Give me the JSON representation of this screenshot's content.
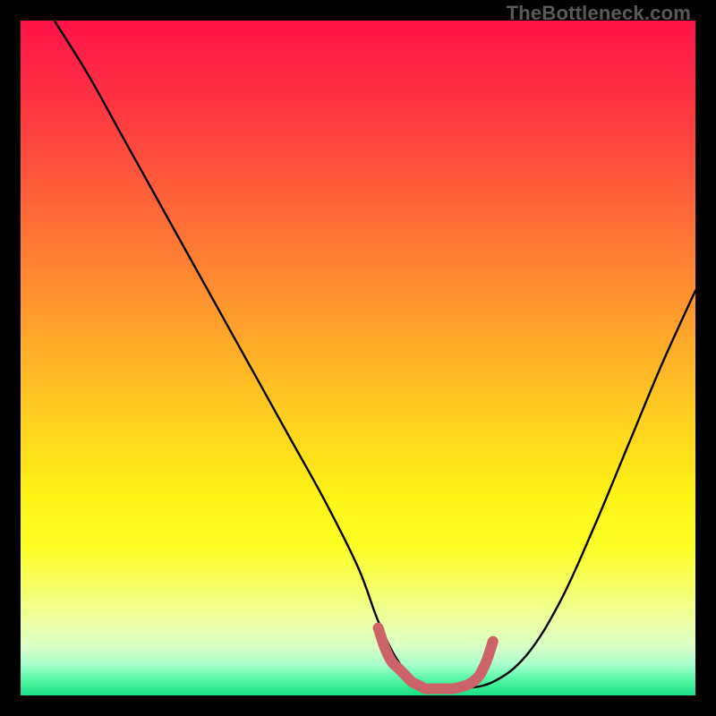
{
  "watermark": "TheBottleneck.com",
  "colors": {
    "black": "#000000",
    "curve_stroke": "#000000",
    "marker_stroke": "#cb6367",
    "gradient_stops": [
      {
        "offset": 0.0,
        "color": "#ff1449"
      },
      {
        "offset": 0.1,
        "color": "#ff2e44"
      },
      {
        "offset": 0.2,
        "color": "#ff4e3e"
      },
      {
        "offset": 0.3,
        "color": "#ff6f37"
      },
      {
        "offset": 0.4,
        "color": "#ff9030"
      },
      {
        "offset": 0.5,
        "color": "#ffb228"
      },
      {
        "offset": 0.6,
        "color": "#ffd31f"
      },
      {
        "offset": 0.7,
        "color": "#fff317"
      },
      {
        "offset": 0.78,
        "color": "#feff25"
      },
      {
        "offset": 0.84,
        "color": "#f7ff68"
      },
      {
        "offset": 0.89,
        "color": "#edffa3"
      },
      {
        "offset": 0.93,
        "color": "#d7ffc9"
      },
      {
        "offset": 0.955,
        "color": "#a6ffcb"
      },
      {
        "offset": 0.975,
        "color": "#58f9a8"
      },
      {
        "offset": 1.0,
        "color": "#18e083"
      }
    ]
  },
  "chart_data": {
    "type": "line",
    "title": "",
    "xlabel": "",
    "ylabel": "",
    "xlim": [
      0,
      100
    ],
    "ylim": [
      0,
      100
    ],
    "grid": false,
    "legend": false,
    "series": [
      {
        "name": "bottleneck-curve",
        "x": [
          5,
          10,
          15,
          20,
          25,
          30,
          35,
          40,
          45,
          50,
          53,
          56,
          59,
          62,
          65,
          70,
          75,
          80,
          85,
          90,
          95,
          100
        ],
        "y": [
          100,
          92,
          83,
          74,
          65,
          56,
          47,
          38,
          29,
          19,
          11,
          5,
          2,
          1,
          1,
          2,
          6,
          14,
          25,
          37,
          49,
          60
        ]
      },
      {
        "name": "optimal-range-marker",
        "x": [
          53,
          54,
          55,
          56,
          57,
          58,
          59,
          60,
          61,
          62,
          63,
          64,
          65,
          66,
          67,
          68,
          69,
          70
        ],
        "y": [
          10,
          7,
          5,
          4,
          3,
          2,
          1.5,
          1,
          1,
          1,
          1,
          1,
          1.2,
          1.5,
          2,
          3,
          5,
          8
        ]
      }
    ],
    "annotations": []
  }
}
